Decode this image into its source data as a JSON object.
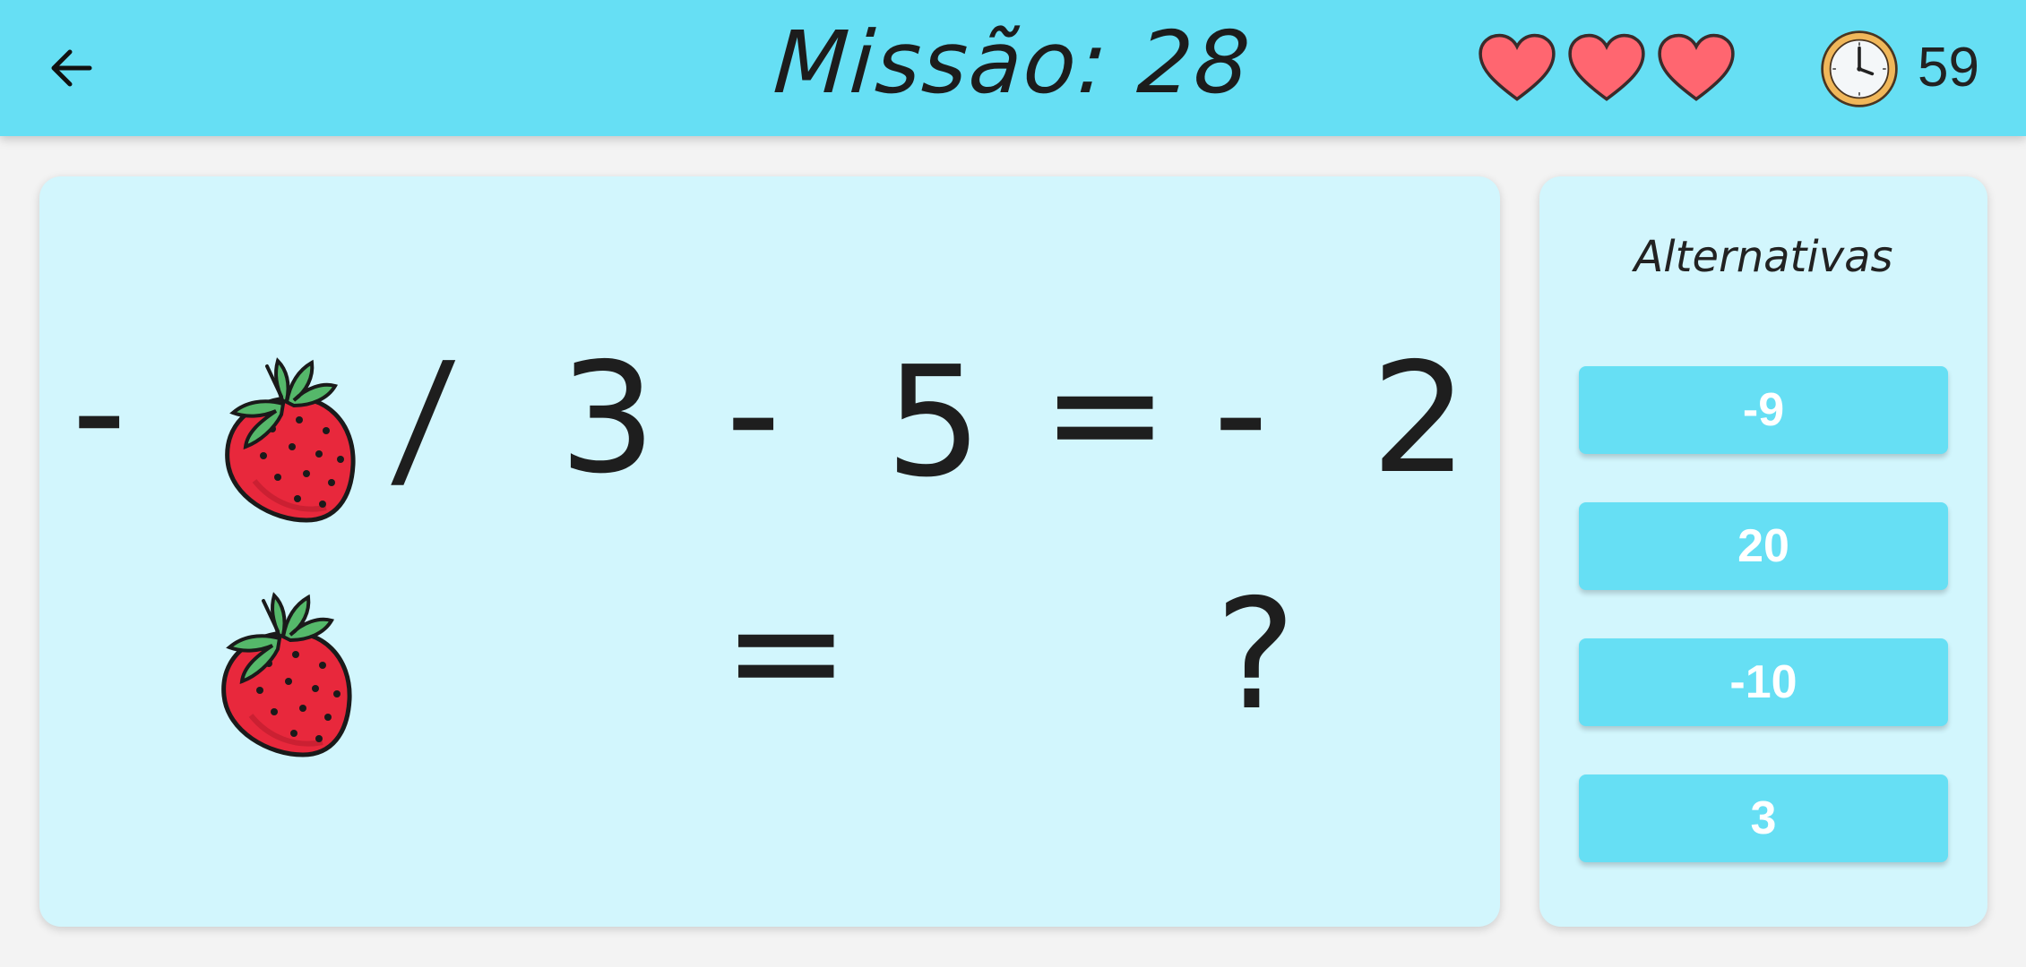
{
  "header": {
    "title": "Missão: 28",
    "lives": 3,
    "timer": "59"
  },
  "icons": {
    "back": "arrow-left-icon",
    "heart": "heart-icon",
    "clock": "clock-icon",
    "fruit": "strawberry-icon"
  },
  "colors": {
    "accent": "#66dff4",
    "board": "#d2f6fd",
    "heart": "#ff6670",
    "text": "#1e1e1e"
  },
  "equation1": {
    "minus_lead": "-",
    "divide": "/",
    "divisor": "3",
    "minus": "-",
    "subtrahend": "5",
    "equals": "=",
    "result_sign": "-",
    "result": "2"
  },
  "equation2": {
    "equals": "=",
    "unknown": "?"
  },
  "panel": {
    "title": "Alternativas",
    "options": [
      "-9",
      "20",
      "-10",
      "3"
    ]
  }
}
